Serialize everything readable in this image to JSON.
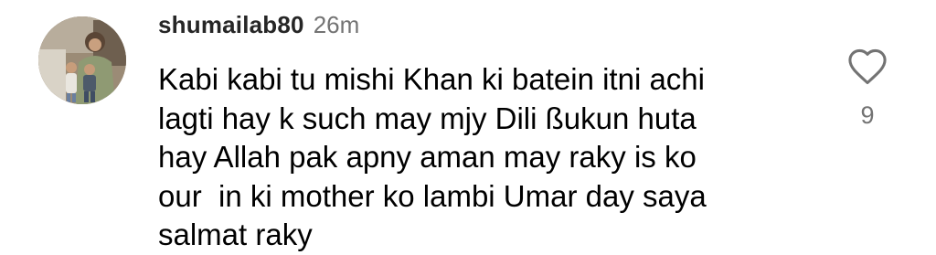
{
  "comment": {
    "username": "shumailab80",
    "time": "26m",
    "text_lines": [
      "Kabi kabi tu mishi Khan ki batein itni achi",
      "lagti hay k such may mjy Dili ßukun huta",
      "hay Allah pak apny aman may raky is ko",
      "our  in ki mother ko lambi Umar day saya",
      "salmat raky"
    ],
    "likes": "9"
  },
  "icons": {
    "like": "heart-outline-icon"
  },
  "colors": {
    "text": "#000000",
    "secondary": "#737373"
  }
}
